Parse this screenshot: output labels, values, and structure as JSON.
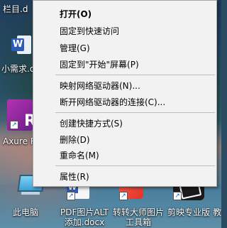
{
  "desktop": {
    "icons": [
      {
        "label": "栏目.d"
      },
      {
        "label": "小需求.d"
      },
      {
        "label": "Axure R"
      },
      {
        "label": "此电脑"
      },
      {
        "label": "PDF图片ALT 添加.docx"
      },
      {
        "label": "转转大师图片 工具箱"
      },
      {
        "label": "剪映专业版"
      },
      {
        "label": "教"
      }
    ],
    "icon_glyphs": {
      "word": "W",
      "axure": "R",
      "shortcut": "↗"
    }
  },
  "context_menu": {
    "items": [
      {
        "label": "打开(O)",
        "bold": true
      },
      {
        "label": "固定到快速访问"
      },
      {
        "label": "管理(G)"
      },
      {
        "label": "固定到\"开始\"屏幕(P)"
      },
      {
        "label": "映射网络驱动器(N)..."
      },
      {
        "label": "断开网络驱动器的连接(C)..."
      },
      {
        "label": "创建快捷方式(S)"
      },
      {
        "label": "删除(D)"
      },
      {
        "label": "重命名(M)"
      },
      {
        "label": "属性(R)"
      }
    ]
  }
}
